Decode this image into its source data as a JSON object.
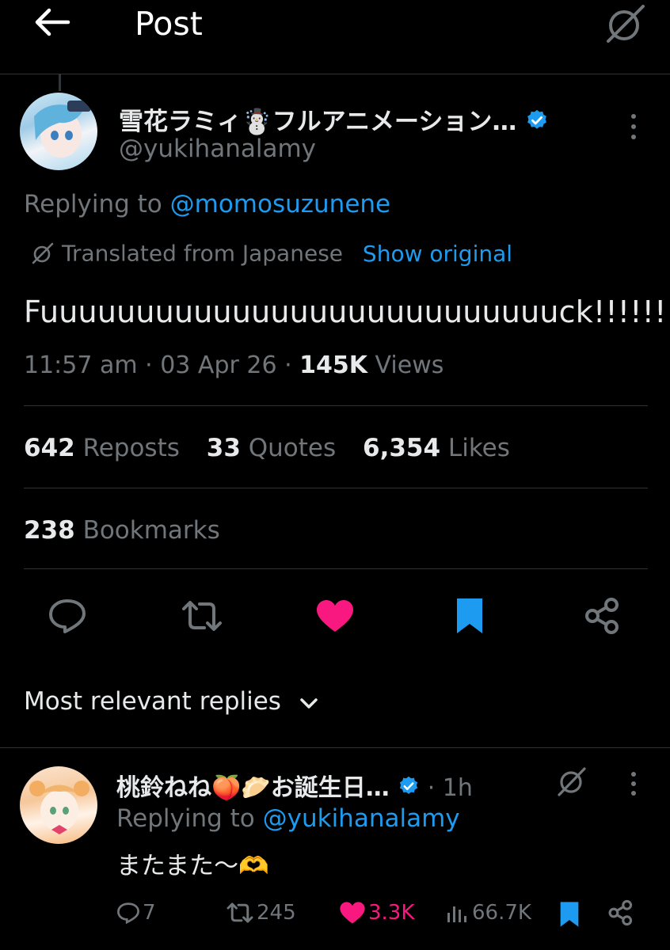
{
  "header": {
    "title": "Post"
  },
  "post": {
    "display_name": "雪花ラミィ☃️フルアニメーション…",
    "handle": "@yukihanalamy",
    "replying_prefix": "Replying to ",
    "replying_to": "@momosuzunene",
    "translated_label": "Translated from Japanese",
    "show_original": "Show original",
    "text": "Fuuuuuuuuuuuuuuuuuuuuuuuuuuuck!!!!!!",
    "time": "11:57 am · 03 Apr 26 · ",
    "views_count": "145K",
    "views_label": " Views",
    "stats": {
      "reposts_count": "642",
      "reposts_label": " Reposts",
      "quotes_count": "33",
      "quotes_label": " Quotes",
      "likes_count": "6,354",
      "likes_label": " Likes",
      "bookmarks_count": "238",
      "bookmarks_label": " Bookmarks"
    },
    "liked": true,
    "bookmarked": true
  },
  "replies_filter": {
    "label": "Most relevant replies"
  },
  "reply": {
    "display_name": "桃鈴ねね🍑🥟お誕生日…",
    "time": " · 1h",
    "replying_prefix": "Replying to ",
    "replying_to": "@yukihanalamy",
    "text": "またまた〜🫶",
    "replies": "7",
    "reposts": "245",
    "likes": "3.3K",
    "views": "66.7K"
  },
  "colors": {
    "background": "#000000",
    "accent_blue": "#1d9bf0",
    "like_pink": "#f91880",
    "muted": "#71767b",
    "verified": "#1d9bf0"
  },
  "icons": [
    "back-arrow-icon",
    "grok-icon",
    "verified-badge-icon",
    "more-vertical-icon",
    "reply-icon",
    "repost-icon",
    "heart-icon",
    "bookmark-icon",
    "share-icon",
    "chevron-down-icon",
    "views-icon"
  ]
}
